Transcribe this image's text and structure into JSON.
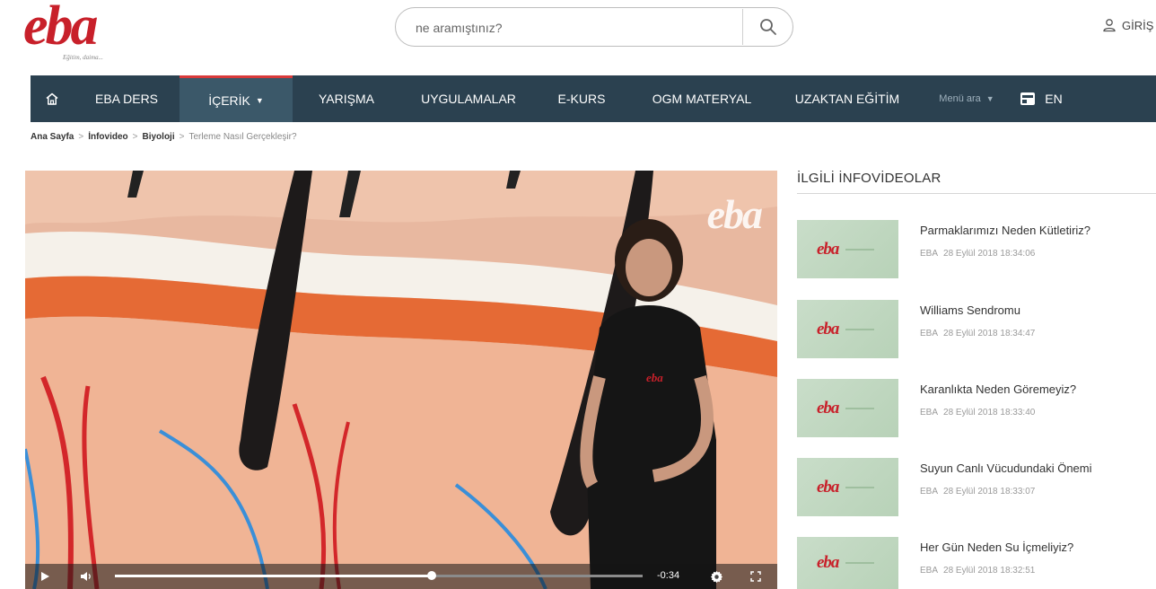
{
  "header": {
    "logo_text": "eba",
    "logo_tagline": "Eğitim, daima...",
    "search_placeholder": "ne aramıştınız?",
    "login_label": "GİRİŞ"
  },
  "nav": {
    "items": [
      {
        "label": "EBA DERS"
      },
      {
        "label": "İÇERİK"
      },
      {
        "label": "YARIŞMA"
      },
      {
        "label": "UYGULAMALAR"
      },
      {
        "label": "E-KURS"
      },
      {
        "label": "OGM MATERYAL"
      },
      {
        "label": "UZAKTAN EĞİTİM"
      }
    ],
    "menu_search": "Menü ara",
    "lang": "EN"
  },
  "breadcrumb": {
    "items": [
      "Ana Sayfa",
      "İnfovideo",
      "Biyoloji"
    ],
    "current": "Terleme Nasıl Gerçekleşir?",
    "separator": ">"
  },
  "video": {
    "watermark": "eba",
    "time_remaining": "-0:34",
    "progress": 0.6
  },
  "related": {
    "title": "İLGİLİ İNFOVİDEOLAR",
    "items": [
      {
        "title": "Parmaklarımızı Neden Kütletiriz?",
        "source": "EBA",
        "date": "28 Eylül 2018 18:34:06"
      },
      {
        "title": "Williams Sendromu",
        "source": "EBA",
        "date": "28 Eylül 2018 18:34:47"
      },
      {
        "title": "Karanlıkta Neden Göremeyiz?",
        "source": "EBA",
        "date": "28 Eylül 2018 18:33:40"
      },
      {
        "title": "Suyun Canlı Vücudundaki Önemi",
        "source": "EBA",
        "date": "28 Eylül 2018 18:33:07"
      },
      {
        "title": "Her Gün Neden Su İçmeliyiz?",
        "source": "EBA",
        "date": "28 Eylül 2018 18:32:51"
      }
    ]
  },
  "icons": {
    "home": "home-icon",
    "search": "search-icon",
    "user": "user-icon",
    "play": "play-icon",
    "volume": "volume-icon",
    "settings": "gear-icon",
    "fullscreen": "fullscreen-icon",
    "caret": "chevron-down-icon",
    "lang": "language-icon"
  },
  "colors": {
    "brand_red": "#c8202a",
    "nav_bg": "#2b4150",
    "nav_active_bg": "#3b5869",
    "nav_active_border": "#d93a3a"
  }
}
